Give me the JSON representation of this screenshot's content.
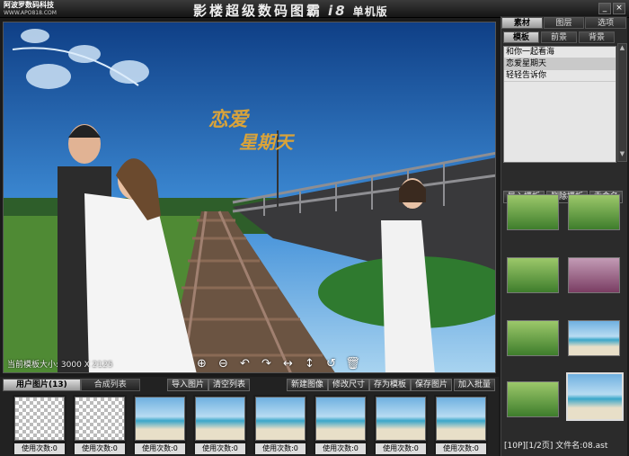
{
  "window": {
    "brand": "阿波罗数码科技",
    "brand_url": "WWW.APO818.COM",
    "title": "影楼超级数码图霸",
    "version": "i8",
    "edition": "单机版",
    "minimize": "_",
    "close": "×"
  },
  "canvas": {
    "status": "当前模板大小: 3000 X 2125",
    "overlay_text_line1": "恋爱",
    "overlay_text_line2": "星期天",
    "tools": [
      "zoom-in-icon",
      "zoom-out-icon",
      "rotate-left-icon",
      "rotate-right-icon",
      "flip-horizontal-icon",
      "flip-vertical-icon",
      "undo-icon",
      "delete-icon"
    ]
  },
  "right_panel": {
    "tabs": [
      "素材",
      "图层",
      "选项"
    ],
    "active_tab": 0,
    "subtabs": [
      "模板",
      "前景",
      "背景"
    ],
    "active_subtab": 0,
    "templates": [
      "和你一起看海",
      "恋爱星期天",
      "轻轻告诉你"
    ],
    "selected_template": 1,
    "buttons": [
      "导入模板",
      "删除模板",
      "重命名"
    ],
    "status": "[10P][1/2页] 文件名:08.ast"
  },
  "bottom": {
    "tabs": [
      "用户图片(13)",
      "合成列表"
    ],
    "active_tab": 0,
    "left_buttons": [
      "导入图片",
      "清空列表"
    ],
    "right_buttons": [
      "新建图像",
      "修改尺寸",
      "存为模板",
      "保存图片",
      "加入批量"
    ],
    "usage_label": "使用次数:0",
    "pictures": 8
  }
}
